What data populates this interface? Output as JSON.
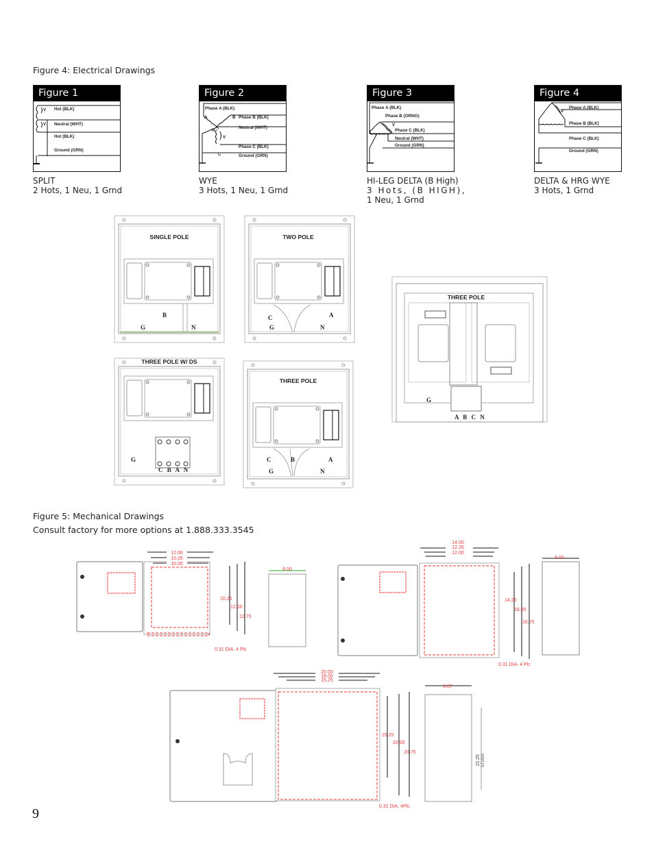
{
  "figure4": {
    "heading": "Figure 4:  Electrical Drawings",
    "figures": [
      {
        "title": "Figure 1",
        "wires": [
          "Hot (BLK)",
          "Neutral (WHT)",
          "Hot (BLK)",
          "Ground (GRN)"
        ],
        "voltage_marks": [
          "V",
          "V"
        ],
        "caption_line1": "SPLIT",
        "caption_line2": "2 Hots, 1 Neu, 1 Grnd"
      },
      {
        "title": "Figure 2",
        "wires": [
          "Phase A (BLK)",
          "Phase B (BLK)",
          "Neutral (WHT)",
          "Phase C (BLK)",
          "Ground (GRN)"
        ],
        "nodes": [
          "A",
          "B",
          "N",
          "C",
          "V"
        ],
        "caption_line1": "WYE",
        "caption_line2": "3 Hots, 1 Neu, 1 Grnd"
      },
      {
        "title": "Figure 3",
        "wires": [
          "Phase A (BLK)",
          "Phase B (ORNG)",
          "Phase C (BLK)",
          "Neutral (WHT)",
          "Ground (GRN)"
        ],
        "voltage_marks": [
          "V"
        ],
        "caption_line1": "HI-LEG DELTA (B High)",
        "caption_line2": "3 Hots, (B HIGH),",
        "caption_line3": "1 Neu, 1 Grnd"
      },
      {
        "title": "Figure 4",
        "wires": [
          "Phase A (BLK)",
          "Phase B (BLK)",
          "Phase C (BLK)",
          "Ground (GRN)"
        ],
        "voltage_marks": [
          "V"
        ],
        "caption_line1": "DELTA & HRG WYE",
        "caption_line2": "3 Hots, 1 Grnd"
      }
    ],
    "panels": [
      {
        "title": "SINGLE POLE",
        "terminals": [
          "B",
          "G",
          "N"
        ]
      },
      {
        "title": "TWO POLE",
        "terminals": [
          "C",
          "A",
          "G",
          "N"
        ]
      },
      {
        "title": "THREE POLE W/ DS",
        "terminals": [
          "G",
          "C B A N"
        ]
      },
      {
        "title": "THREE POLE",
        "terminals": [
          "C",
          "B",
          "A",
          "G",
          "N"
        ]
      },
      {
        "title": "THREE POLE",
        "terminals": [
          "G",
          "A B C N"
        ]
      }
    ]
  },
  "figure5": {
    "heading": "Figure 5:  Mechanical Drawings",
    "subheading": "Consult factory for more options at 1.888.333.3545",
    "drawings": [
      {
        "widths": [
          "12.00",
          "10.26",
          "10.00"
        ],
        "heights": [
          "10.25",
          "12.00",
          "12.75"
        ],
        "hole_note": "0.31 DIA. 4 Plc",
        "depth": "6.00"
      },
      {
        "widths": [
          "14.00",
          "12.26",
          "12.00"
        ],
        "heights": [
          "14.25",
          "16.00",
          "16.75"
        ],
        "hole_note": "0.31 DIA. 4 Plc",
        "depth": "6.00"
      },
      {
        "widths": [
          "20.00",
          "18.00",
          "15.25"
        ],
        "heights": [
          "15.25",
          "20.00",
          "20.75"
        ],
        "hole_note": "0.31 DIA. 4Plc",
        "depth": "8.87",
        "stud_label": "15.25",
        "stud_note": "STUDS"
      }
    ]
  },
  "page_number": "9"
}
